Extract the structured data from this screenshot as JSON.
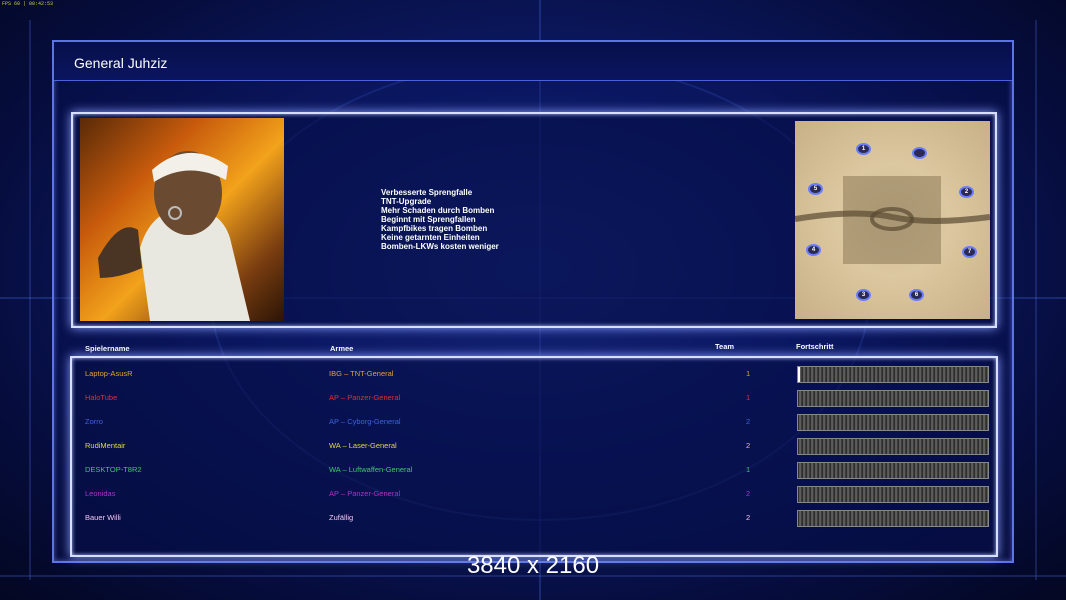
{
  "system": {
    "corner_text": "FPS 60 | 00:42:53"
  },
  "screen": {
    "title": "General Juhziz",
    "resolution_label": "3840 x 2160"
  },
  "general": {
    "perks": [
      "Verbesserte Sprengfalle",
      "TNT-Upgrade",
      "Mehr Schaden durch Bomben",
      "Beginnt mit Sprengfallen",
      "Kampfbikes tragen Bomben",
      "Keine getarnten Einheiten",
      "Bomben-LKWs kosten weniger"
    ]
  },
  "map": {
    "start_positions": [
      "1",
      "",
      "2",
      "3",
      "4",
      "5",
      "6",
      "7"
    ]
  },
  "table": {
    "headers": {
      "player": "Spielername",
      "army": "Armee",
      "team": "Team",
      "progress": "Fortschritt"
    },
    "rows": [
      {
        "player": "Laptop-AsusR",
        "army": "IBG – TNT-General",
        "team": "1",
        "color": "#e8a030",
        "progress": 0.01
      },
      {
        "player": "HaloTube",
        "army": "AP – Panzer-General",
        "team": "1",
        "color": "#e03030",
        "progress": 0
      },
      {
        "player": "Zorro",
        "army": "AP – Cyborg-General",
        "team": "2",
        "color": "#3a63d8",
        "progress": 0
      },
      {
        "player": "RudiMentair",
        "army": "WA – Laser-General",
        "team": "2",
        "color": "#e6d840",
        "progress": 0
      },
      {
        "player": "DESKTOP-T8R2",
        "army": "WA – Luftwaffen-General",
        "team": "1",
        "color": "#3ec86a",
        "progress": 0
      },
      {
        "player": "Leonidas",
        "army": "AP – Panzer-General",
        "team": "2",
        "color": "#b030c8",
        "progress": 0
      },
      {
        "player": "Bauer Willi",
        "army": "Zufällig",
        "team": "2",
        "color": "#f0c8f0",
        "progress": 0
      }
    ]
  }
}
